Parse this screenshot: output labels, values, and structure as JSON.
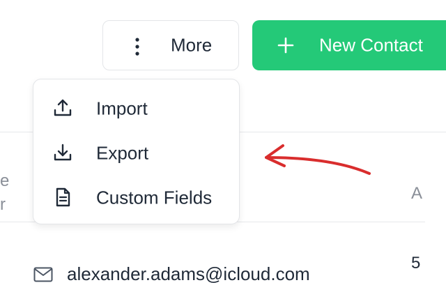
{
  "toolbar": {
    "more_label": "More",
    "new_contact_label": "New Contact",
    "colors": {
      "primary": "#24c978",
      "text": "#1f2937"
    }
  },
  "more_menu": {
    "items": [
      {
        "label": "Import",
        "icon": "upload-icon"
      },
      {
        "label": "Export",
        "icon": "download-icon"
      },
      {
        "label": "Custom Fields",
        "icon": "document-icon"
      }
    ]
  },
  "table": {
    "partial_header_left": "e\nr",
    "partial_header_right": "A",
    "rows": [
      {
        "email": "alexander.adams@icloud.com",
        "partial_right": "5"
      }
    ]
  },
  "annotation": {
    "color": "#d92d2d",
    "shape": "arrow"
  }
}
